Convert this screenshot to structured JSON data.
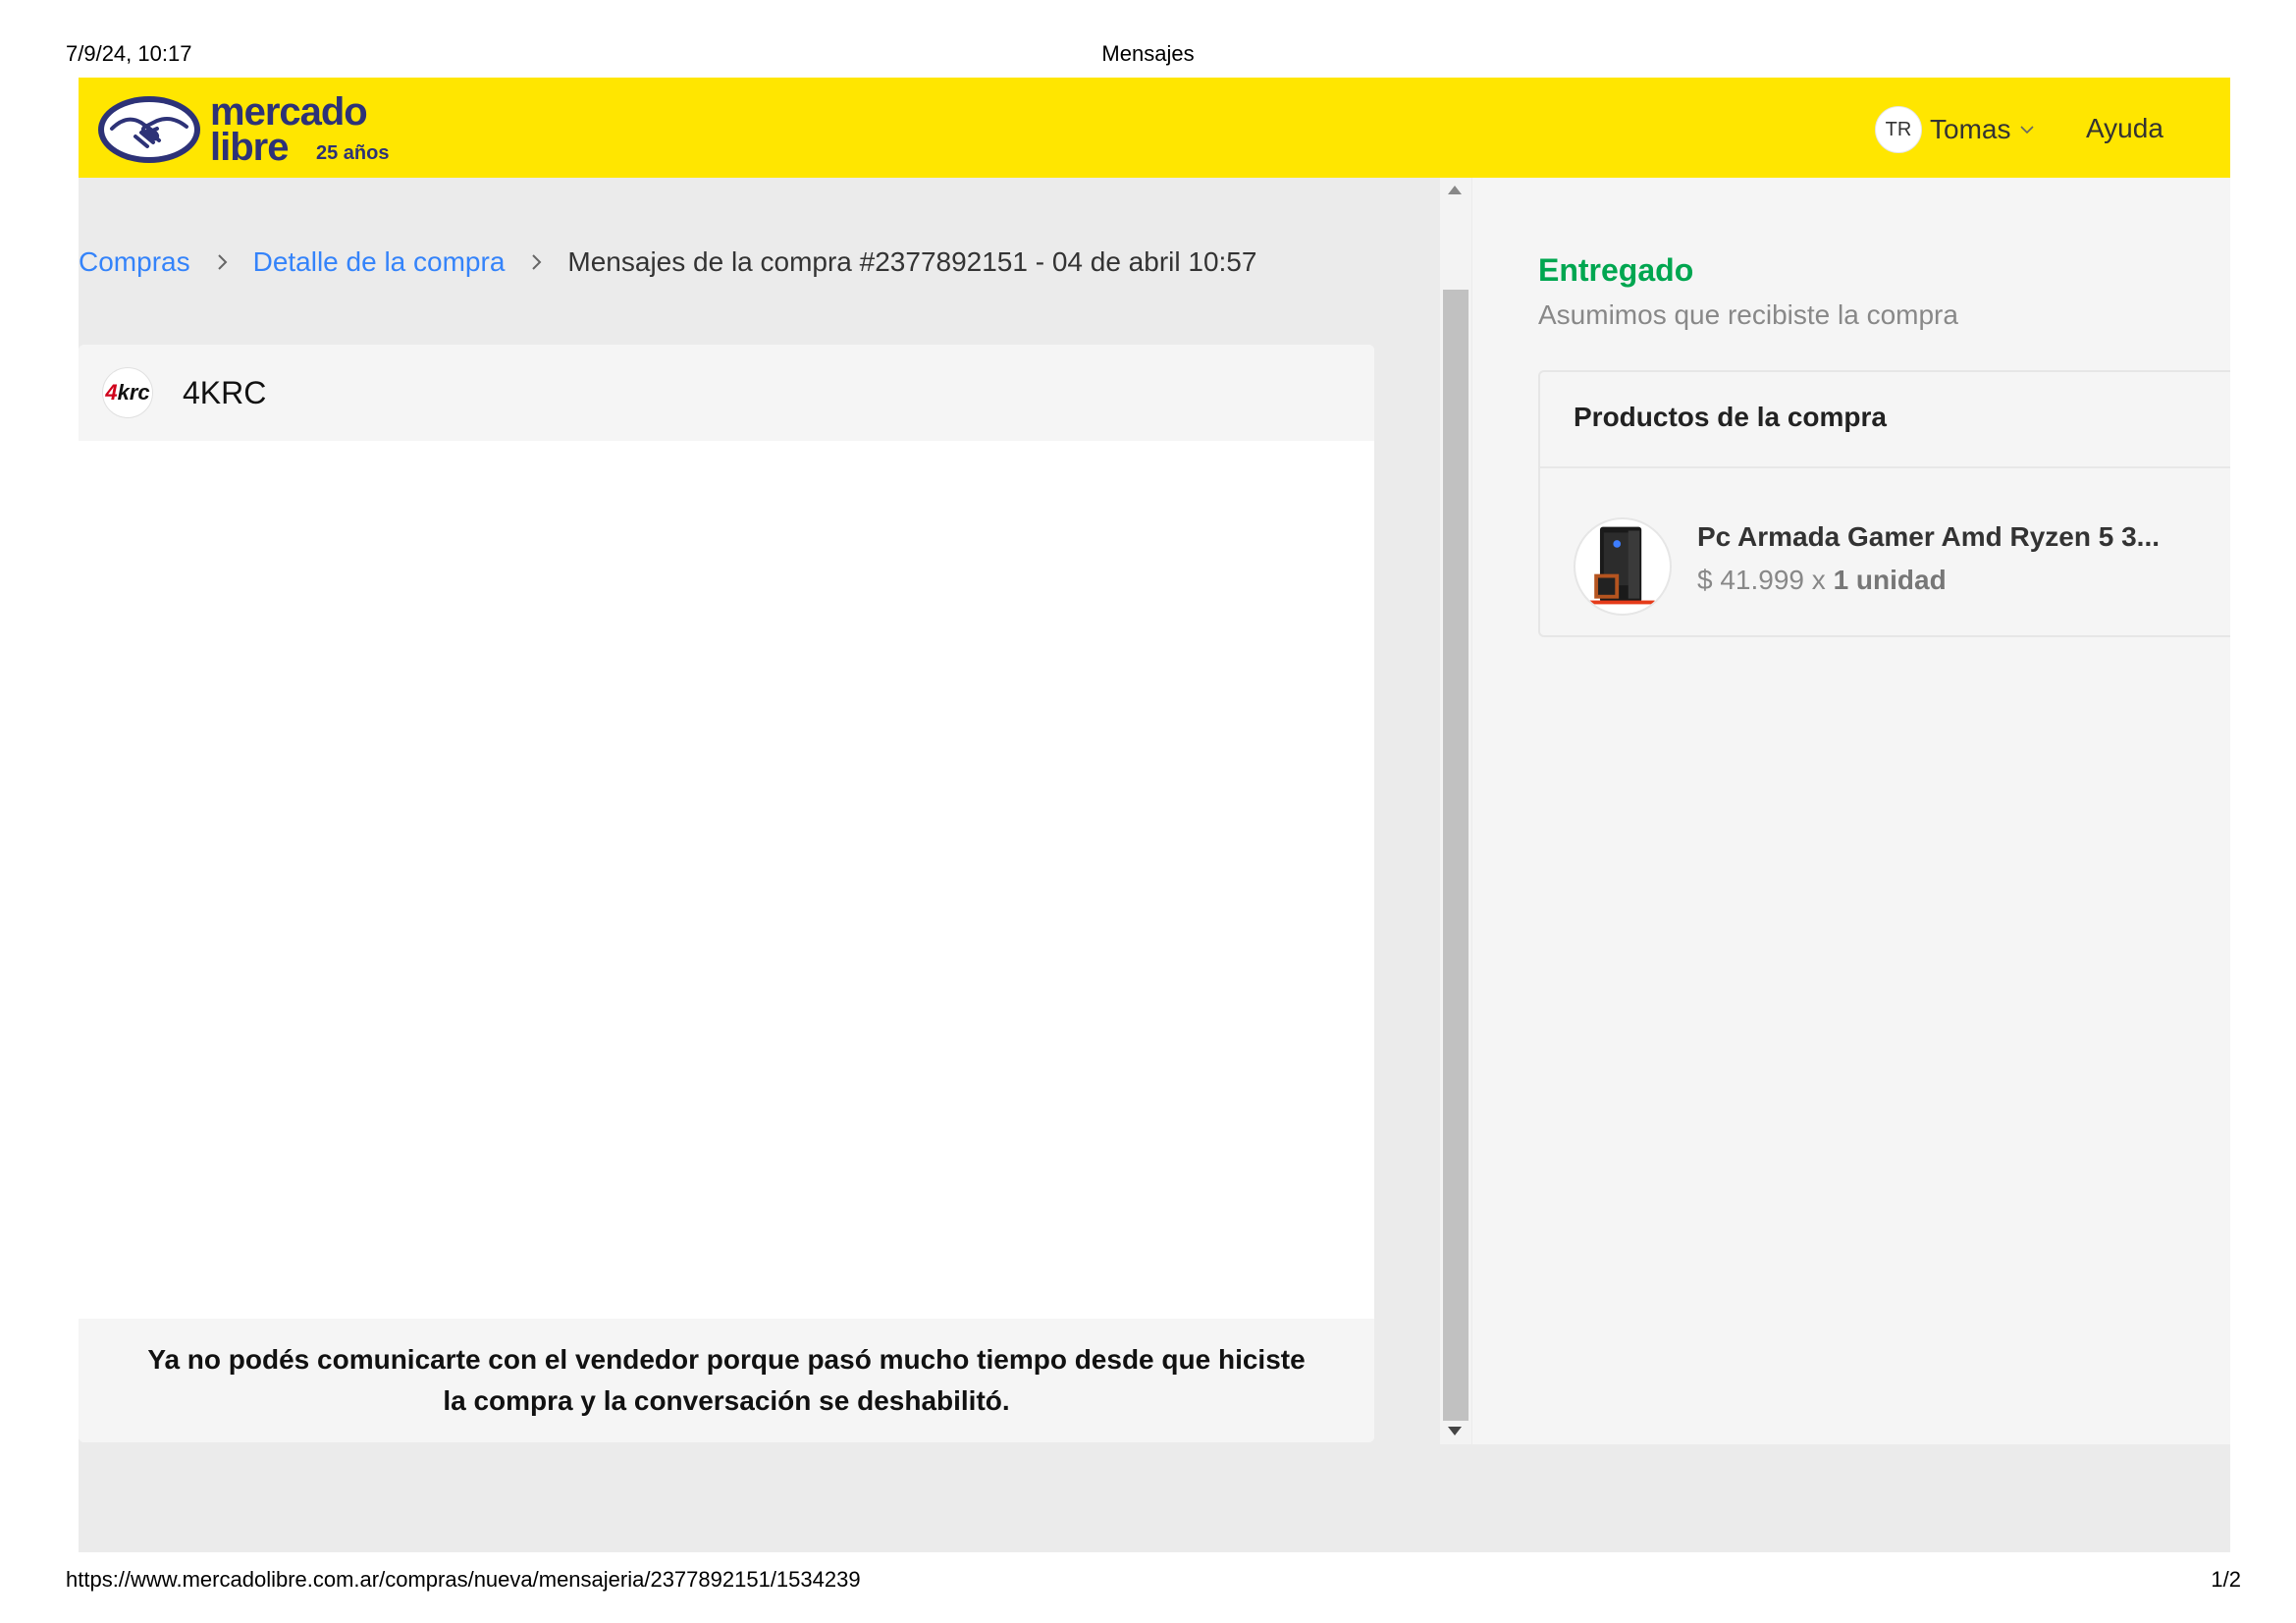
{
  "print": {
    "datetime": "7/9/24, 10:17",
    "title": "Mensajes",
    "url": "https://www.mercadolibre.com.ar/compras/nueva/mensajeria/2377892151/1534239",
    "page": "1/2"
  },
  "header": {
    "logo_word1": "mercado",
    "logo_word2": "libre",
    "logo_years": "25 años",
    "user_initials": "TR",
    "user_name": "Tomas",
    "help": "Ayuda",
    "colors": {
      "bar": "#ffe600",
      "logo": "#2d3277"
    }
  },
  "breadcrumb": {
    "items": [
      {
        "label": "Compras"
      },
      {
        "label": "Detalle de la compra"
      }
    ],
    "current": "Mensajes de la compra #2377892151 - 04 de abril 10:57"
  },
  "chat": {
    "seller_logo_text": "4krc",
    "seller_name": "4KRC",
    "disabled_message": "Ya no podés comunicarte con el vendedor porque pasó mucho tiempo desde que hiciste la compra y la conversación se deshabilitó."
  },
  "status": {
    "title": "Entregado",
    "subtitle": "Asumimos que recibiste la compra",
    "color": "#00a650"
  },
  "products": {
    "title": "Productos de la compra",
    "items": [
      {
        "name": "Pc Armada Gamer Amd Ryzen 5 3...",
        "price": "$ 41.999",
        "times": "x",
        "quantity": "1 unidad",
        "image_icon": "pc-tower-icon"
      }
    ]
  },
  "links_color": "#3483fa"
}
